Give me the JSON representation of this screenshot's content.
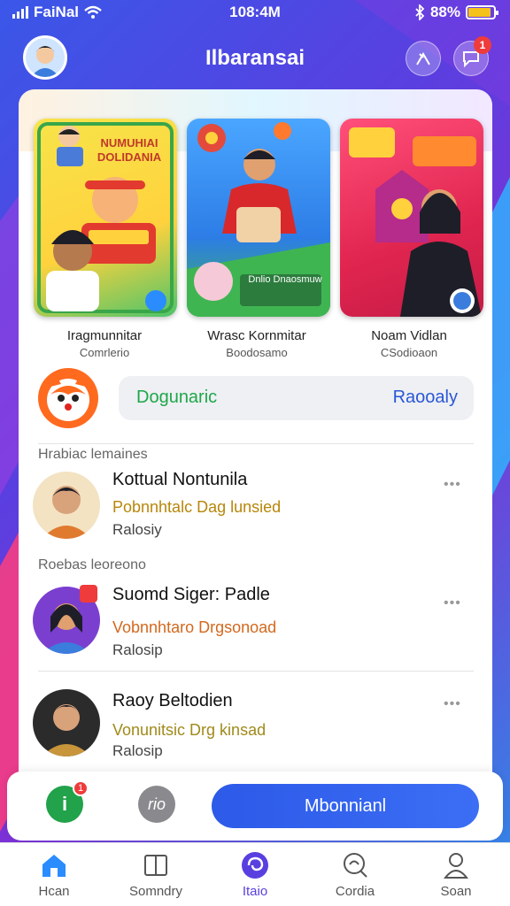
{
  "status": {
    "carrier": "FaiNal",
    "time": "108:4M",
    "battery": "88%",
    "battery_level": 0.88
  },
  "header": {
    "title": "Ilbaransai",
    "notification_count": "1"
  },
  "featured": [
    {
      "poster_text": "NUMUHIAI DOLIDANIA",
      "label": "Iragmunnitar",
      "sub": "Comrlerio"
    },
    {
      "poster_text": "Dnlio Dnaosmuw",
      "label": "Wrasc Kornmitar",
      "sub": "Boodosamo"
    },
    {
      "poster_text": "",
      "label": "Noam Vidlan",
      "sub": "CSodioaon"
    }
  ],
  "tags": {
    "left": "Dogunaric",
    "right": "Raooaly"
  },
  "sections": [
    "Hrabiac lemaines",
    "Roebas leoreono"
  ],
  "people": [
    {
      "name": "Kottual Nontunila",
      "status": "Pobnnhtalc Dag lunsied",
      "meta": "Ralosiy",
      "status_color": "#b8860b"
    },
    {
      "name": "Suomd Siger: Padle",
      "status": "Vobnnhtaro Drgsonoad",
      "meta": "Ralosip",
      "status_color": "#d2691e"
    },
    {
      "name": "Raoy Beltodien",
      "status": "Vonunitsic Drg kinsad",
      "meta": "Ralosip",
      "status_color": "#a08a1a"
    }
  ],
  "more_label": "•••",
  "actions": {
    "badge": "1",
    "secondary_icon_text": "rio",
    "primary_label": "Mbonnianl",
    "green_icon_text": "i"
  },
  "tabs": [
    {
      "label": "Hcan",
      "icon": "home-icon",
      "color": "#2a8cff"
    },
    {
      "label": "Somndry",
      "icon": "book-icon",
      "color": "#555555"
    },
    {
      "label": "Itaio",
      "icon": "spiral-icon",
      "color": "#5a3fe0"
    },
    {
      "label": "Cordia",
      "icon": "search-icon",
      "color": "#555555"
    },
    {
      "label": "Soan",
      "icon": "person-icon",
      "color": "#555555"
    }
  ]
}
